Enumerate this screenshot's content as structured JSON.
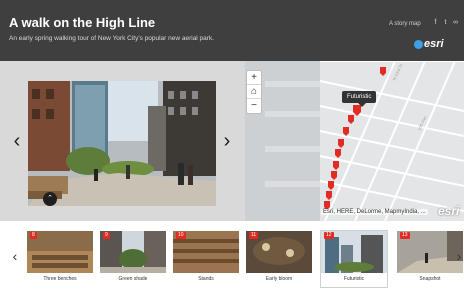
{
  "header": {
    "title": "A walk on the High Line",
    "subtitle": "An early spring walking tour of New York City's popular new aerial park.",
    "story_map_link": "A story map",
    "brand": "esri"
  },
  "map": {
    "tooltip": "Futuristic",
    "attribution": "Esri, HERE, DeLorme, MapmyIndia, ...",
    "watermark": "esri",
    "markers": [
      "5",
      "12",
      "14",
      "15",
      "16",
      "18",
      "19",
      "20",
      "21",
      "22",
      "23",
      "24"
    ],
    "marker_color": "#e22b22"
  },
  "carousel": {
    "items": [
      {
        "number": "8",
        "caption": "Three benches"
      },
      {
        "number": "9",
        "caption": "Green shade"
      },
      {
        "number": "10",
        "caption": "Stands"
      },
      {
        "number": "11",
        "caption": "Early bloom"
      },
      {
        "number": "12",
        "caption": "Futuristic"
      },
      {
        "number": "13",
        "caption": "Snapshot"
      }
    ],
    "active_index": 4
  },
  "icons": {
    "prev": "chevron-left-icon",
    "next": "chevron-right-icon",
    "zoom_in": "plus-icon",
    "home": "home-icon",
    "zoom_out": "minus-icon",
    "facebook": "facebook-icon",
    "twitter": "twitter-icon",
    "link": "link-icon"
  }
}
